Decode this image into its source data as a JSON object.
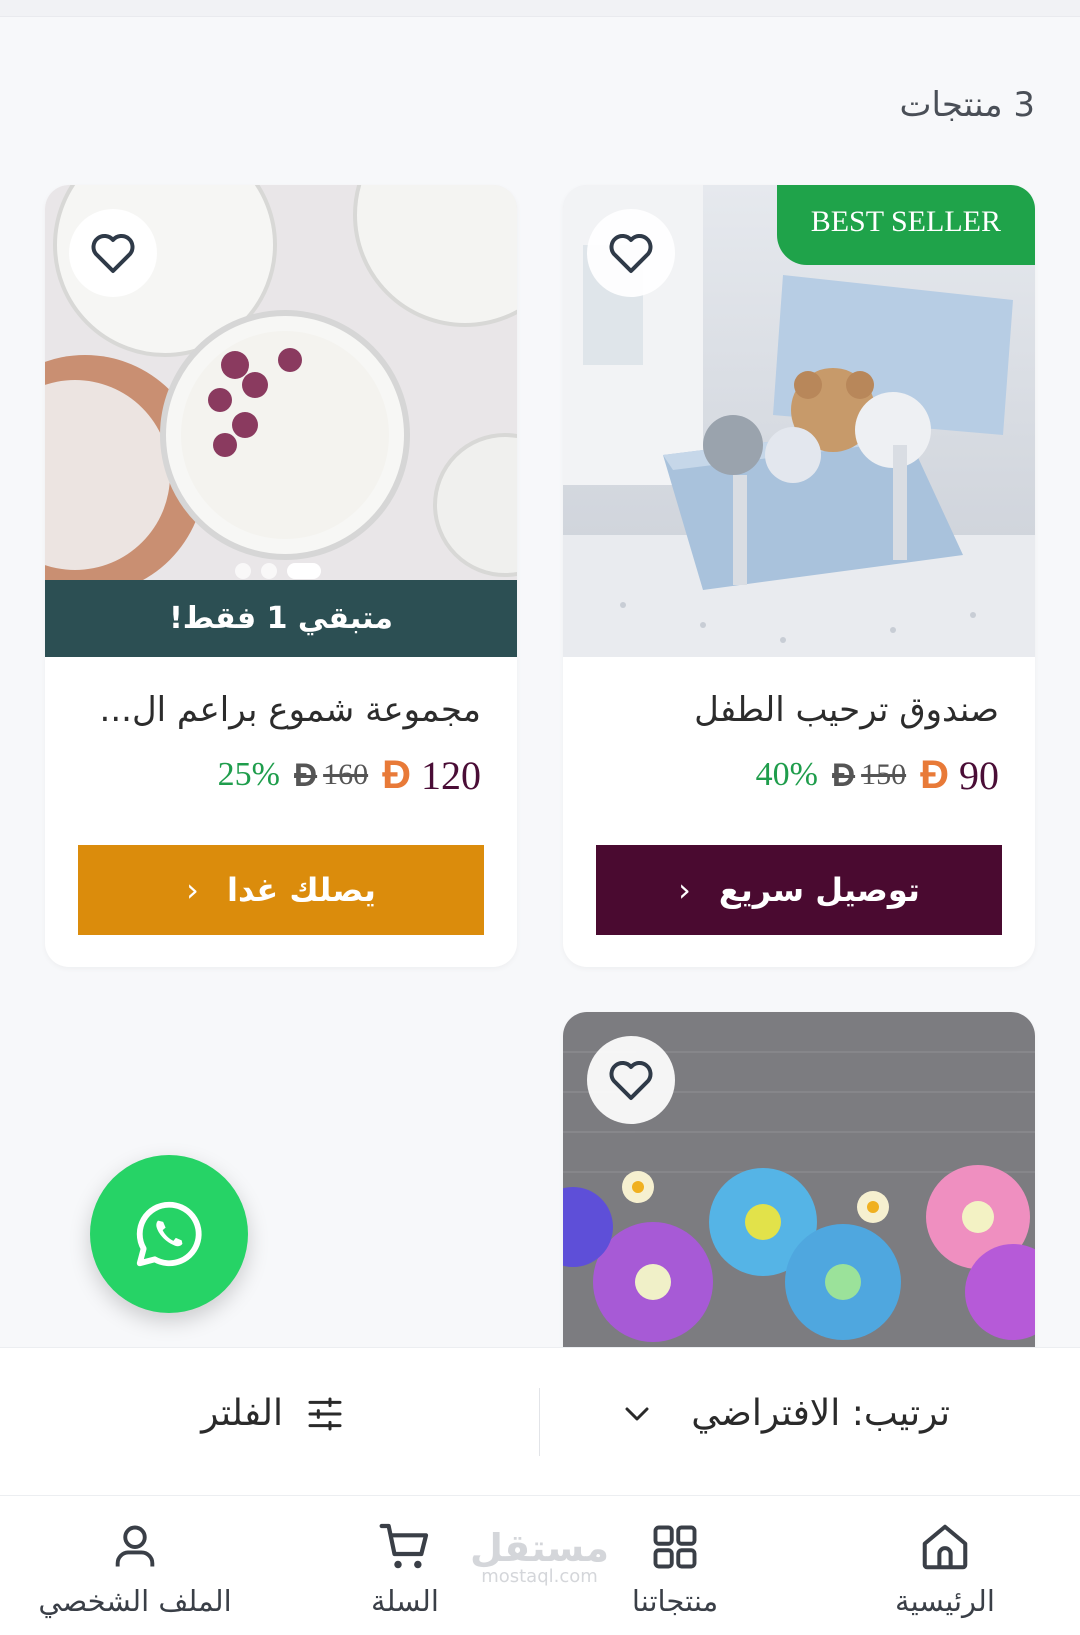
{
  "listing": {
    "count_label": "3 منتجات"
  },
  "products": [
    {
      "badge": "BEST SELLER",
      "title": "صندوق ترحيب الطفل",
      "price": "90",
      "old_price": "150",
      "discount": "40%",
      "cta_label": "توصيل سريع",
      "cta_color": "#4a0a30"
    },
    {
      "stock_label": "متبقي 1 فقط!",
      "title": "مجموعة شموع براعم ال...",
      "price": "120",
      "old_price": "160",
      "discount": "25%",
      "cta_label": "يصلك غدا",
      "cta_color": "#db8c0c",
      "carousel": {
        "count": 3,
        "active": 3
      }
    },
    {}
  ],
  "currency_symbol": "Đ",
  "toolbar": {
    "sort_label": "ترتيب: الافتراضي",
    "filter_label": "الفلتر"
  },
  "nav": {
    "home": "الرئيسية",
    "products": "منتجاتنا",
    "cart": "السلة",
    "profile": "الملف الشخصي"
  },
  "watermark": {
    "arabic": "مستقل",
    "latin": "mostaql.com"
  },
  "colors": {
    "discount": "#1f9d4c",
    "price": "#4a0d36",
    "currency": "#e87a38",
    "badge": "#1fa34a",
    "whatsapp": "#26d366"
  }
}
